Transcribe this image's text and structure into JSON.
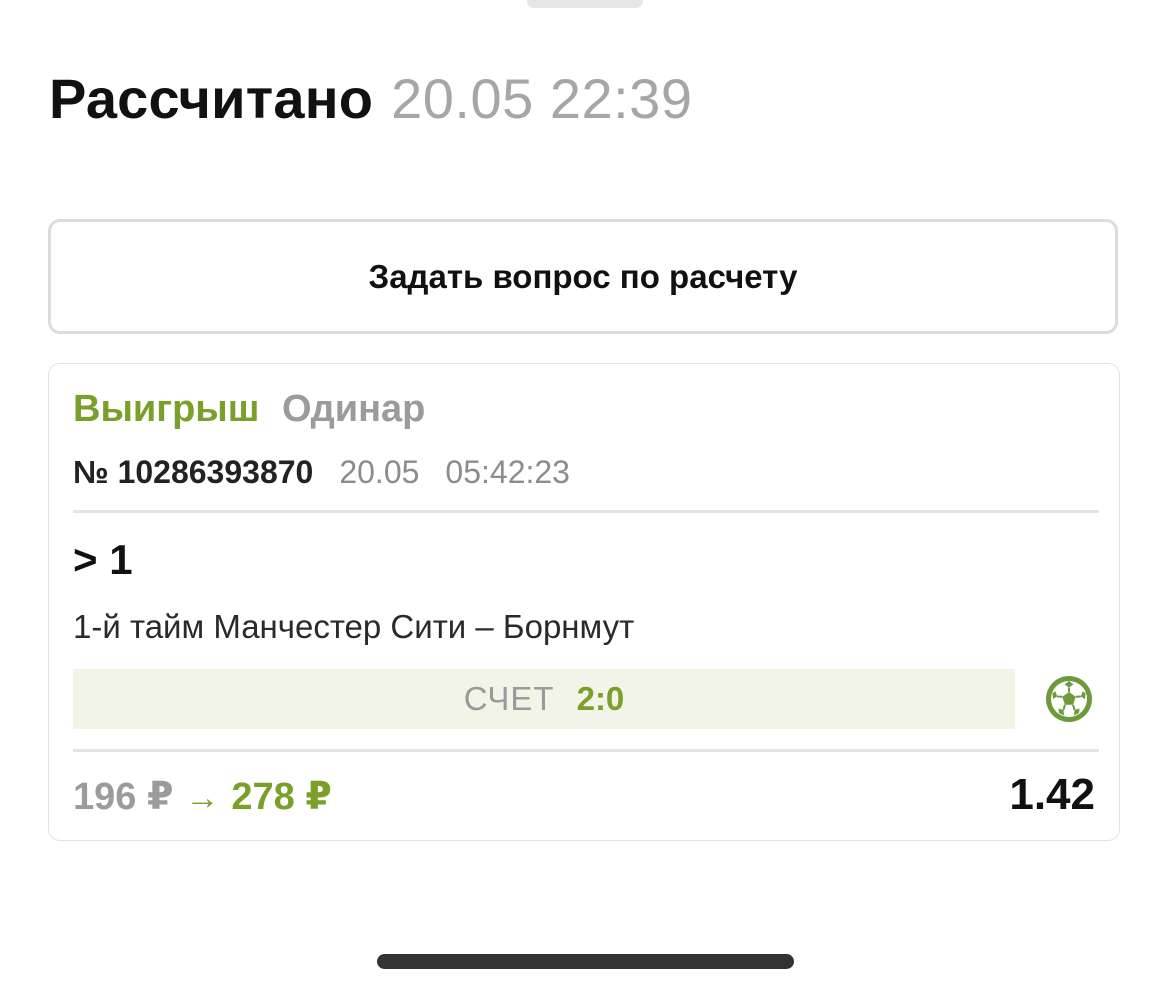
{
  "header": {
    "title": "Рассчитано",
    "datetime": "20.05 22:39"
  },
  "ask_button": {
    "label": "Задать вопрос по расчету"
  },
  "bet_card": {
    "status": "Выигрыш",
    "bet_type": "Одинар",
    "number": "№ 10286393870",
    "date": "20.05",
    "time": "05:42:23",
    "outcome": "> 1",
    "event": "1-й тайм Манчестер Сити – Борнмут",
    "score_label": "СЧЕТ",
    "score_value": "2:0",
    "sport_icon": "football-icon",
    "stake": "196 ₽",
    "arrow": "→",
    "payout": "278 ₽",
    "coefficient": "1.42"
  },
  "colors": {
    "win_green": "#7aa02a",
    "muted_gray": "#9b9b9b",
    "score_bg": "#f2f4e8"
  }
}
